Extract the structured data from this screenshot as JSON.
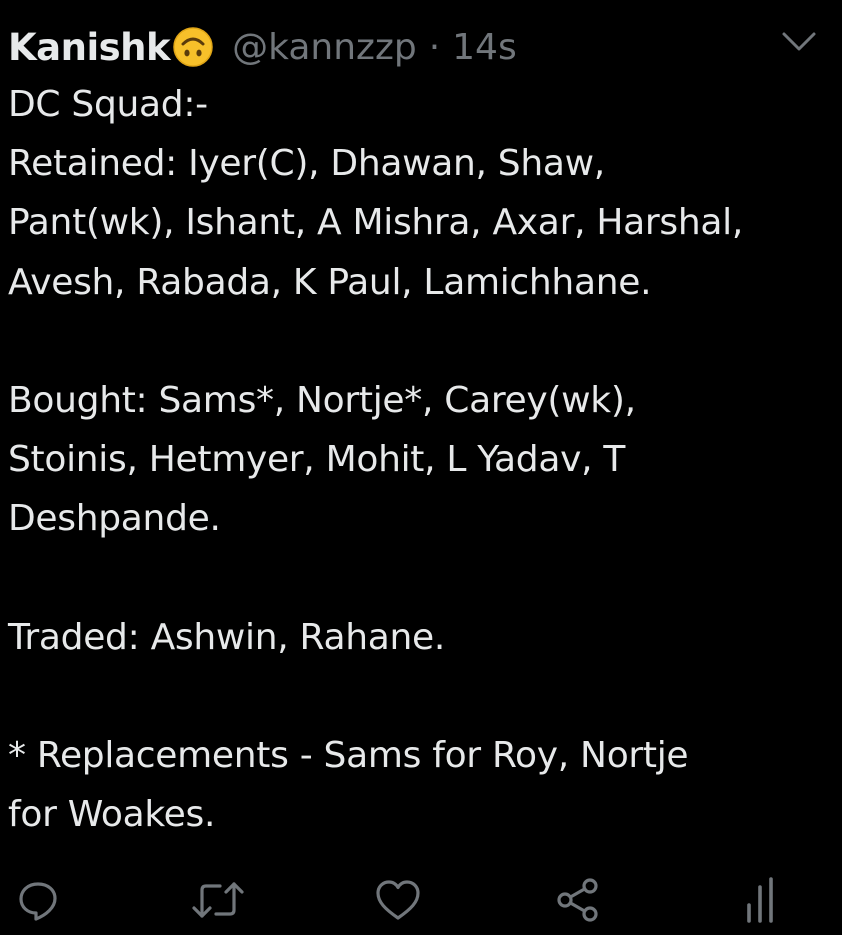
{
  "tweet": {
    "display_name": "Kanishk",
    "emoji_icon": "upside-down-face-emoji",
    "handle": "@kannzzp",
    "separator": "·",
    "timestamp": "14s",
    "lines": [
      "DC Squad:-",
      "Retained: Iyer(C), Dhawan, Shaw,",
      "Pant(wk), Ishant, A Mishra, Axar, Harshal,",
      "Avesh, Rabada, K Paul, Lamichhane.",
      "",
      "Bought: Sams*, Nortje*, Carey(wk),",
      "Stoinis, Hetmyer, Mohit, L Yadav, T",
      "Deshpande.",
      "",
      "Traded: Ashwin, Rahane.",
      "",
      "* Replacements - Sams for Roy, Nortje",
      "for Woakes."
    ]
  },
  "actions": [
    {
      "name": "reply-icon"
    },
    {
      "name": "retweet-icon"
    },
    {
      "name": "like-icon"
    },
    {
      "name": "share-icon"
    },
    {
      "name": "analytics-icon"
    }
  ],
  "colors": {
    "background": "#000000",
    "text": "#e7e9ea",
    "muted": "#71767b",
    "emoji": "#f7c02a"
  }
}
